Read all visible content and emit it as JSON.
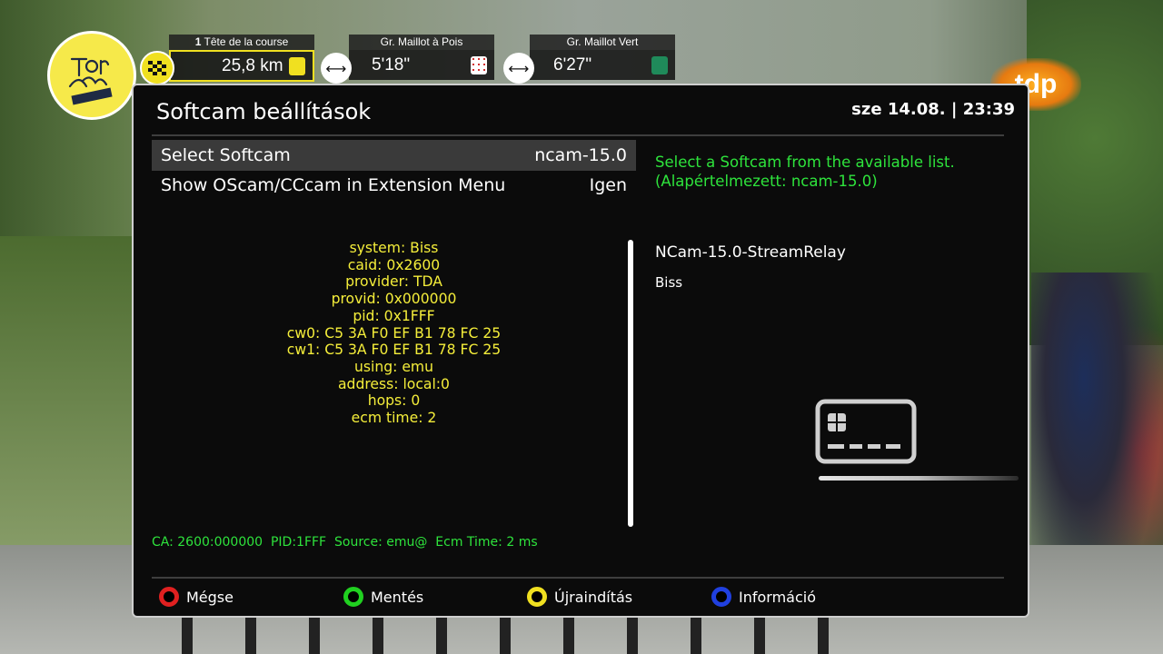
{
  "race": {
    "leader_label": "Tête de la course",
    "leader_rank": "1",
    "leader_value": "25,8 km",
    "pois_label": "Gr. Maillot à Pois",
    "pois_value": "5'18\"",
    "vert_label": "Gr. Maillot Vert",
    "vert_value": "6'27\"",
    "logo_text": "Tour de France Femmes",
    "broadcaster": "tdp",
    "colors": {
      "yellow": "#f0e020",
      "green": "#1f8a5a",
      "pois": "#d33030"
    }
  },
  "osd": {
    "title": "Softcam beállítások",
    "datetime": "sze 14.08. | 23:39",
    "settings": [
      {
        "label": "Select Softcam",
        "value": "ncam-15.0"
      },
      {
        "label": "Show OScam/CCcam in Extension Menu",
        "value": "Igen"
      }
    ],
    "help_line1": "Select a Softcam from the available list.",
    "help_line2": "(Alapértelmezett: ncam-15.0)",
    "ecm_info": [
      "system: Biss",
      "caid: 0x2600",
      "provider: TDA",
      "provid: 0x000000",
      "pid: 0x1FFF",
      "cw0: C5 3A F0 EF B1 78 FC 25",
      "cw1: C5 3A F0 EF B1 78 FC 25",
      "using: emu",
      "address: local:0",
      "hops: 0",
      "ecm time: 2"
    ],
    "cam_name": "NCam-15.0-StreamRelay",
    "cam_system": "Biss",
    "status_line": "CA: 2600:000000  PID:1FFF  Source: emu@  Ecm Time: 2 ms",
    "buttons": {
      "red": "Mégse",
      "green": "Mentés",
      "yellow": "Újraindítás",
      "blue": "Információ"
    },
    "button_colors": {
      "red": "#e02020",
      "green": "#20d020",
      "yellow": "#f0e020",
      "blue": "#2040e0"
    }
  }
}
